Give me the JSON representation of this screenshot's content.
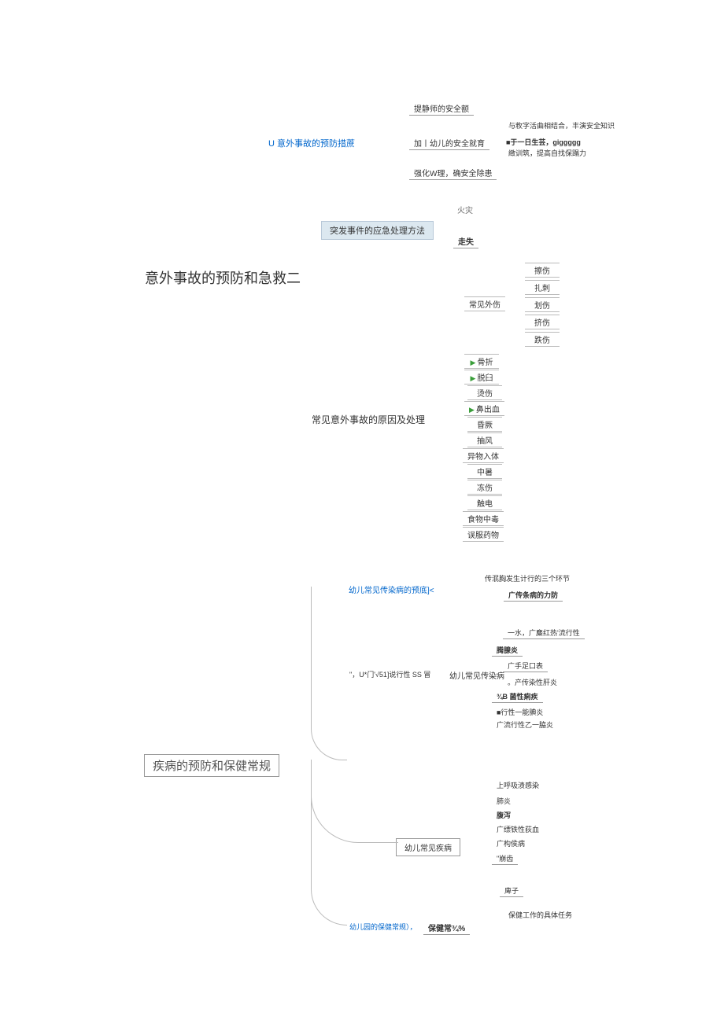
{
  "section1": {
    "root": "U 意外事故的预防措蔗",
    "b1": "提静师的安全额",
    "b2": "加丨幼儿的安全就育",
    "b2_sub1": "与敉字活曲相结合，丰演安全知识",
    "b2_sub2": "■于一日生芸，giggggg",
    "b2_sub3": "緻训筑，提高自找保蹋力",
    "b3": "强化W理，确安全除患"
  },
  "section2": {
    "root": "突发事件的应急处理方法",
    "c1": "火灾",
    "c2": "走失"
  },
  "section3": {
    "title": "意外事故的预防和急救二",
    "root": "常见意外事故的原因及处理",
    "group1": "常见外伤",
    "g1_items": [
      "擦伤",
      "扎刺",
      "划伤",
      "挤伤",
      "跌伤"
    ],
    "items": [
      "骨折",
      "脱臼",
      "烫伤",
      "鼻出血",
      "昏厥",
      "抽风",
      "异物入体",
      "中暑",
      "冻伤",
      "触电",
      "食物中毒",
      "误服药物"
    ]
  },
  "section4": {
    "root": "疾病的预防和保健常规",
    "b1": "幼儿常见传染病的预底]<",
    "b1_sub1": "传泯胸发生计行的三个环节",
    "b1_sub2": "广传条病的力防",
    "b2_pre": "\"，U*门'√51]说行性 SS 冒",
    "b2": "幼儿常见传染病",
    "b2_items": [
      "一水，广麋红热'流行性",
      "腾腺炎",
      "广手足口表",
      "。产传染性肝炎",
      "¾B 菌性痢疾",
      "■行性一能腆炎",
      "广流行性乙一脇炎"
    ],
    "b3": "幼儿常见疾病",
    "b3_items": [
      "上呼吸渍感染",
      "肺炎",
      "腹泻",
      "广缥铁性荻血",
      "广构侯病",
      "\"崩齿",
      "",
      "庳子"
    ],
    "b4_pre": "幼儿园的保健常规），",
    "b4": "保健常¾%",
    "b4_sub": "保健工作的具体任务"
  }
}
